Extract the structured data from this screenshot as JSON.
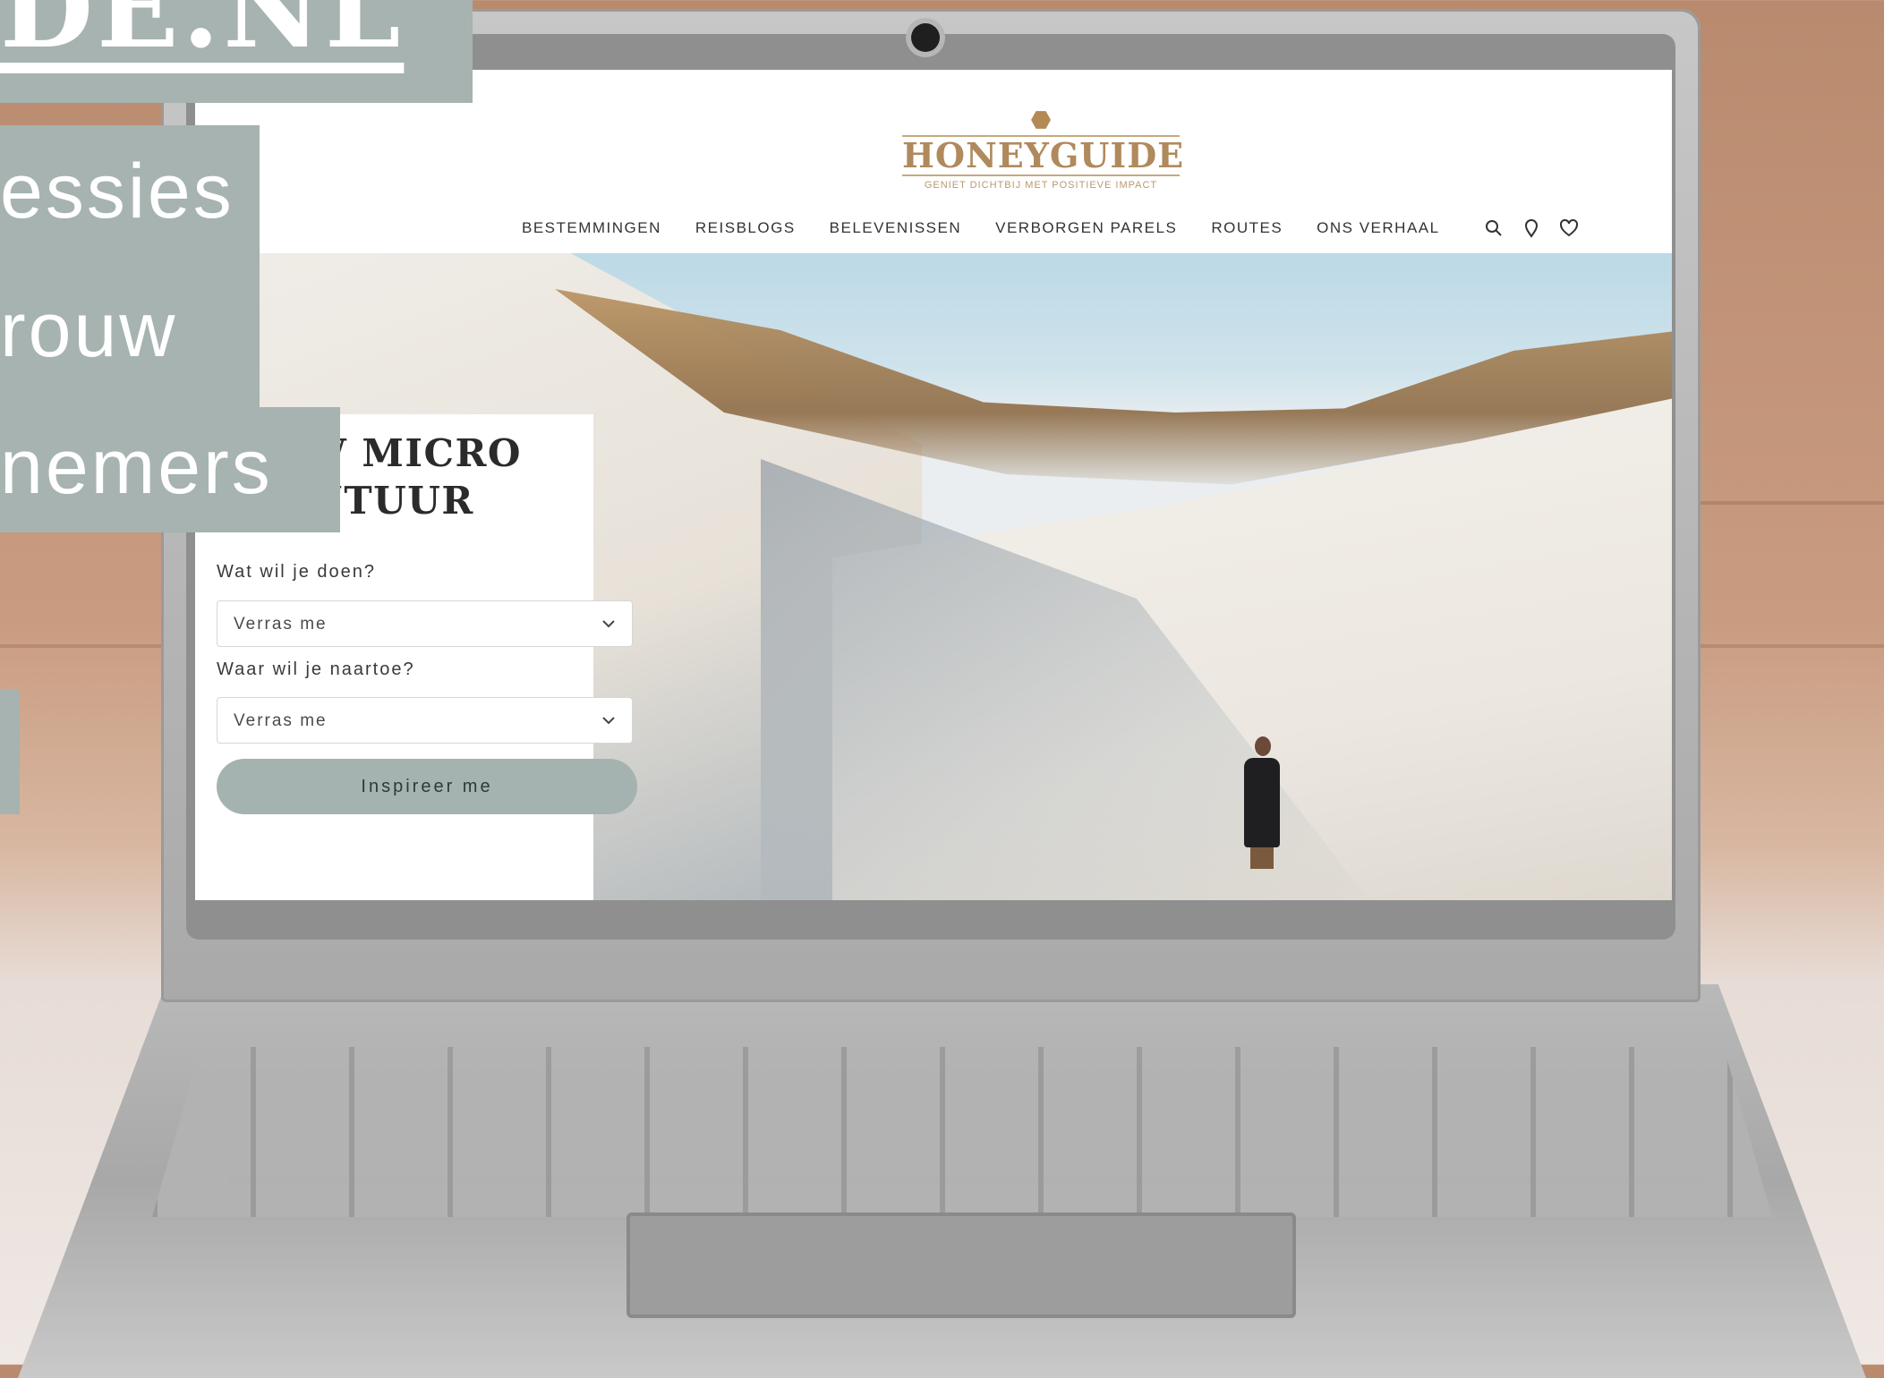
{
  "overlay": {
    "domain_fragment": "DE.NL",
    "lines": [
      "essies",
      "rouw",
      "nemers"
    ]
  },
  "site": {
    "logo_title": "HONEYGUIDE",
    "logo_tagline": "GENIET DICHTBIJ MET POSITIEVE IMPACT",
    "nav": [
      "BESTEMMINGEN",
      "REISBLOGS",
      "BELEVENISSEN",
      "VERBORGEN PARELS",
      "ROUTES",
      "ONS VERHAAL"
    ],
    "nav_icons": [
      "search-icon",
      "location-icon",
      "heart-icon"
    ],
    "card": {
      "title": "JOUW MICRO AVONTUUR",
      "q1_label": "Wat wil je doen?",
      "q1_value": "Verras me",
      "q2_label": "Waar wil je naartoe?",
      "q2_value": "Verras me",
      "button": "Inspireer me"
    }
  },
  "colors": {
    "accent": "#a6b3b0",
    "logo_gold": "#b0895c"
  }
}
